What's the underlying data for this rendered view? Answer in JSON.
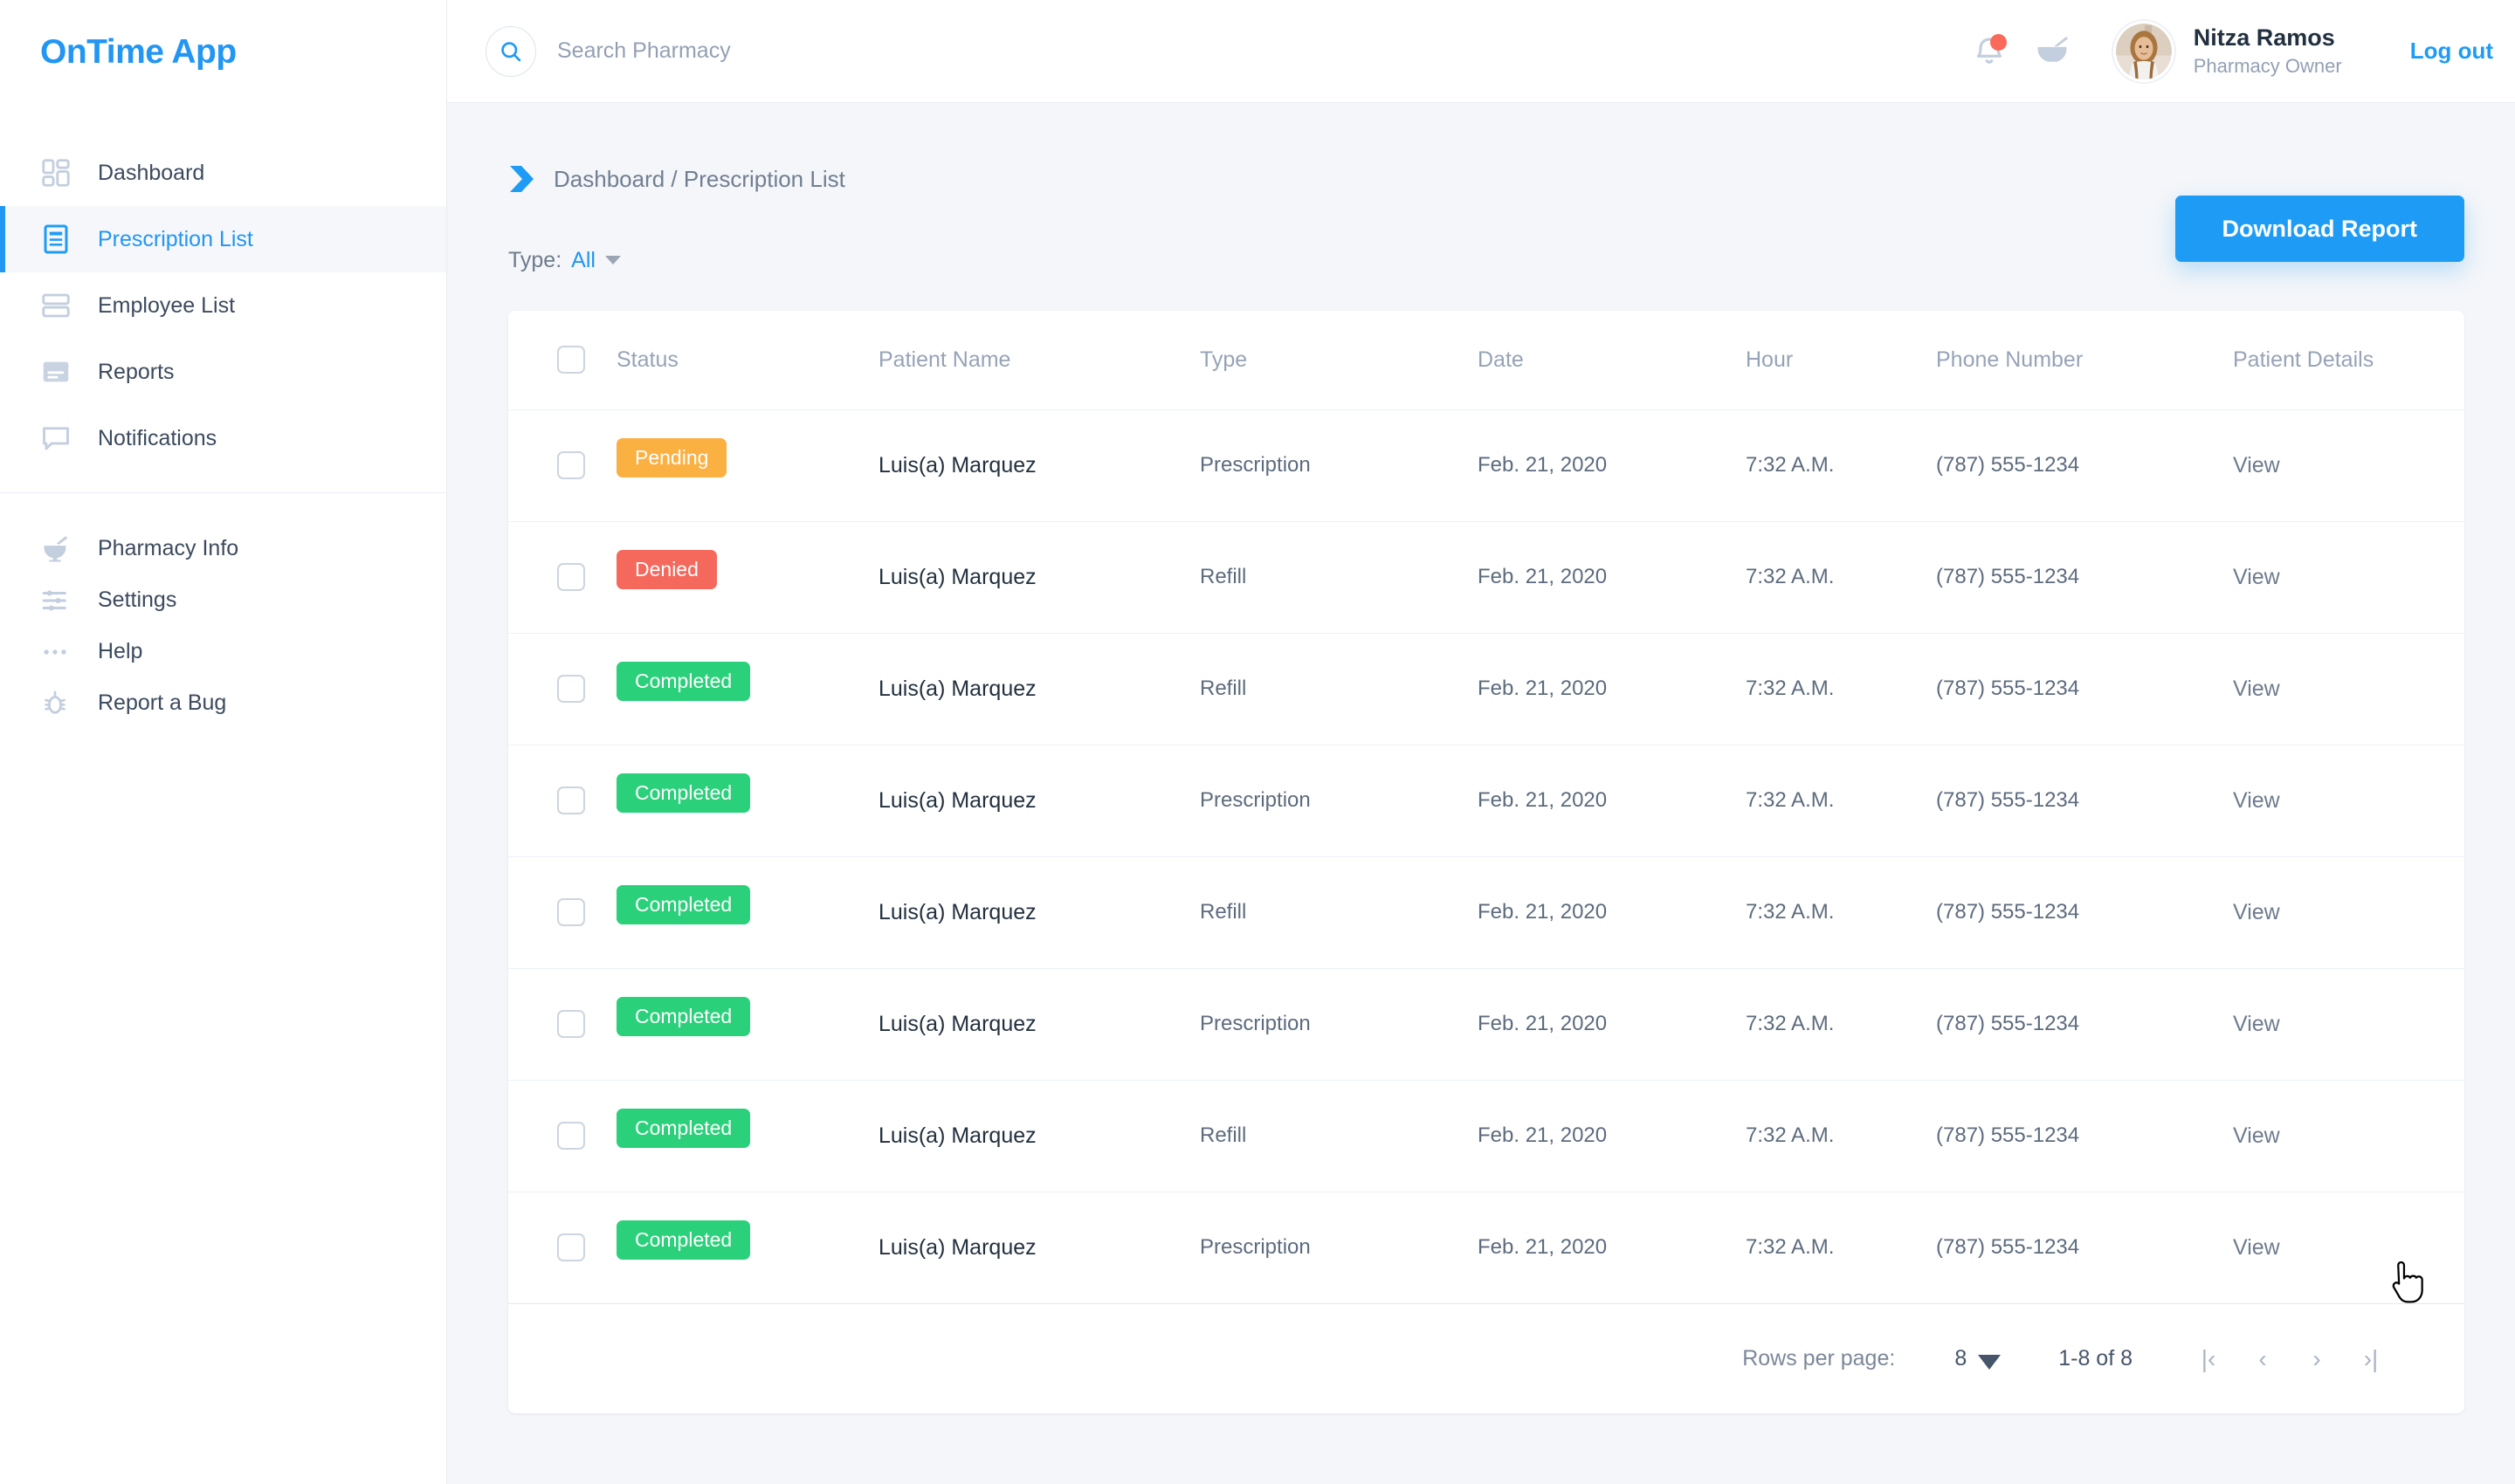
{
  "sidebar": {
    "brand": "OnTime App",
    "primary_items": [
      {
        "label": "Dashboard",
        "icon": "dashboard-grid-icon",
        "active": false
      },
      {
        "label": "Prescription List",
        "icon": "document-lines-icon",
        "active": true
      },
      {
        "label": "Employee List",
        "icon": "stacked-rows-icon",
        "active": false
      },
      {
        "label": "Reports",
        "icon": "report-card-icon",
        "active": false
      },
      {
        "label": "Notifications",
        "icon": "chat-bubble-icon",
        "active": false
      }
    ],
    "secondary_items": [
      {
        "label": "Pharmacy Info",
        "icon": "mortar-pestle-icon"
      },
      {
        "label": "Settings",
        "icon": "sliders-icon"
      },
      {
        "label": "Help",
        "icon": "ellipsis-icon"
      },
      {
        "label": "Report a Bug",
        "icon": "bug-icon"
      }
    ]
  },
  "header": {
    "search_placeholder": "Search Pharmacy",
    "search_value": "",
    "notification_badge": true,
    "user_name": "Nitza Ramos",
    "user_role": "Pharmacy Owner",
    "logout_label": "Log out"
  },
  "breadcrumb": {
    "text": "Dashboard / Prescription List"
  },
  "filter": {
    "type_label": "Type:",
    "type_value": "All"
  },
  "actions": {
    "download_report": "Download Report"
  },
  "table": {
    "columns": [
      "Status",
      "Patient Name",
      "Type",
      "Date",
      "Hour",
      "Phone Number",
      "Patient Details"
    ],
    "rows": [
      {
        "status": "Pending",
        "status_kind": "pending",
        "name": "Luis(a) Marquez",
        "type": "Prescription",
        "date": "Feb. 21, 2020",
        "hour": "7:32 A.M.",
        "phone": "(787) 555-1234",
        "action": "View",
        "checked": false
      },
      {
        "status": "Denied",
        "status_kind": "denied",
        "name": "Luis(a) Marquez",
        "type": "Refill",
        "date": "Feb. 21, 2020",
        "hour": "7:32 A.M.",
        "phone": "(787) 555-1234",
        "action": "View",
        "checked": false
      },
      {
        "status": "Completed",
        "status_kind": "completed",
        "name": "Luis(a) Marquez",
        "type": "Refill",
        "date": "Feb. 21, 2020",
        "hour": "7:32 A.M.",
        "phone": "(787) 555-1234",
        "action": "View",
        "checked": false
      },
      {
        "status": "Completed",
        "status_kind": "completed",
        "name": "Luis(a) Marquez",
        "type": "Prescription",
        "date": "Feb. 21, 2020",
        "hour": "7:32 A.M.",
        "phone": "(787) 555-1234",
        "action": "View",
        "checked": false
      },
      {
        "status": "Completed",
        "status_kind": "completed",
        "name": "Luis(a) Marquez",
        "type": "Refill",
        "date": "Feb. 21, 2020",
        "hour": "7:32 A.M.",
        "phone": "(787) 555-1234",
        "action": "View",
        "checked": false
      },
      {
        "status": "Completed",
        "status_kind": "completed",
        "name": "Luis(a) Marquez",
        "type": "Prescription",
        "date": "Feb. 21, 2020",
        "hour": "7:32 A.M.",
        "phone": "(787) 555-1234",
        "action": "View",
        "checked": false
      },
      {
        "status": "Completed",
        "status_kind": "completed",
        "name": "Luis(a) Marquez",
        "type": "Refill",
        "date": "Feb. 21, 2020",
        "hour": "7:32 A.M.",
        "phone": "(787) 555-1234",
        "action": "View",
        "checked": false
      },
      {
        "status": "Completed",
        "status_kind": "completed",
        "name": "Luis(a) Marquez",
        "type": "Prescription",
        "date": "Feb. 21, 2020",
        "hour": "7:32 A.M.",
        "phone": "(787) 555-1234",
        "action": "View",
        "checked": false
      }
    ]
  },
  "pagination": {
    "rows_per_page_label": "Rows per page:",
    "rows_per_page_value": "8",
    "range_text": "1-8 of 8",
    "first_label": "|‹",
    "prev_label": "‹",
    "next_label": "›",
    "last_label": "›|"
  },
  "colors": {
    "accent": "#1e9cf5",
    "brand": "#2196f3",
    "pending": "#fbb042",
    "denied": "#f5685c",
    "completed": "#2bd07a",
    "page_bg": "#f4f6f9",
    "text_dark": "#22303f",
    "text_muted": "#96a3b7"
  }
}
